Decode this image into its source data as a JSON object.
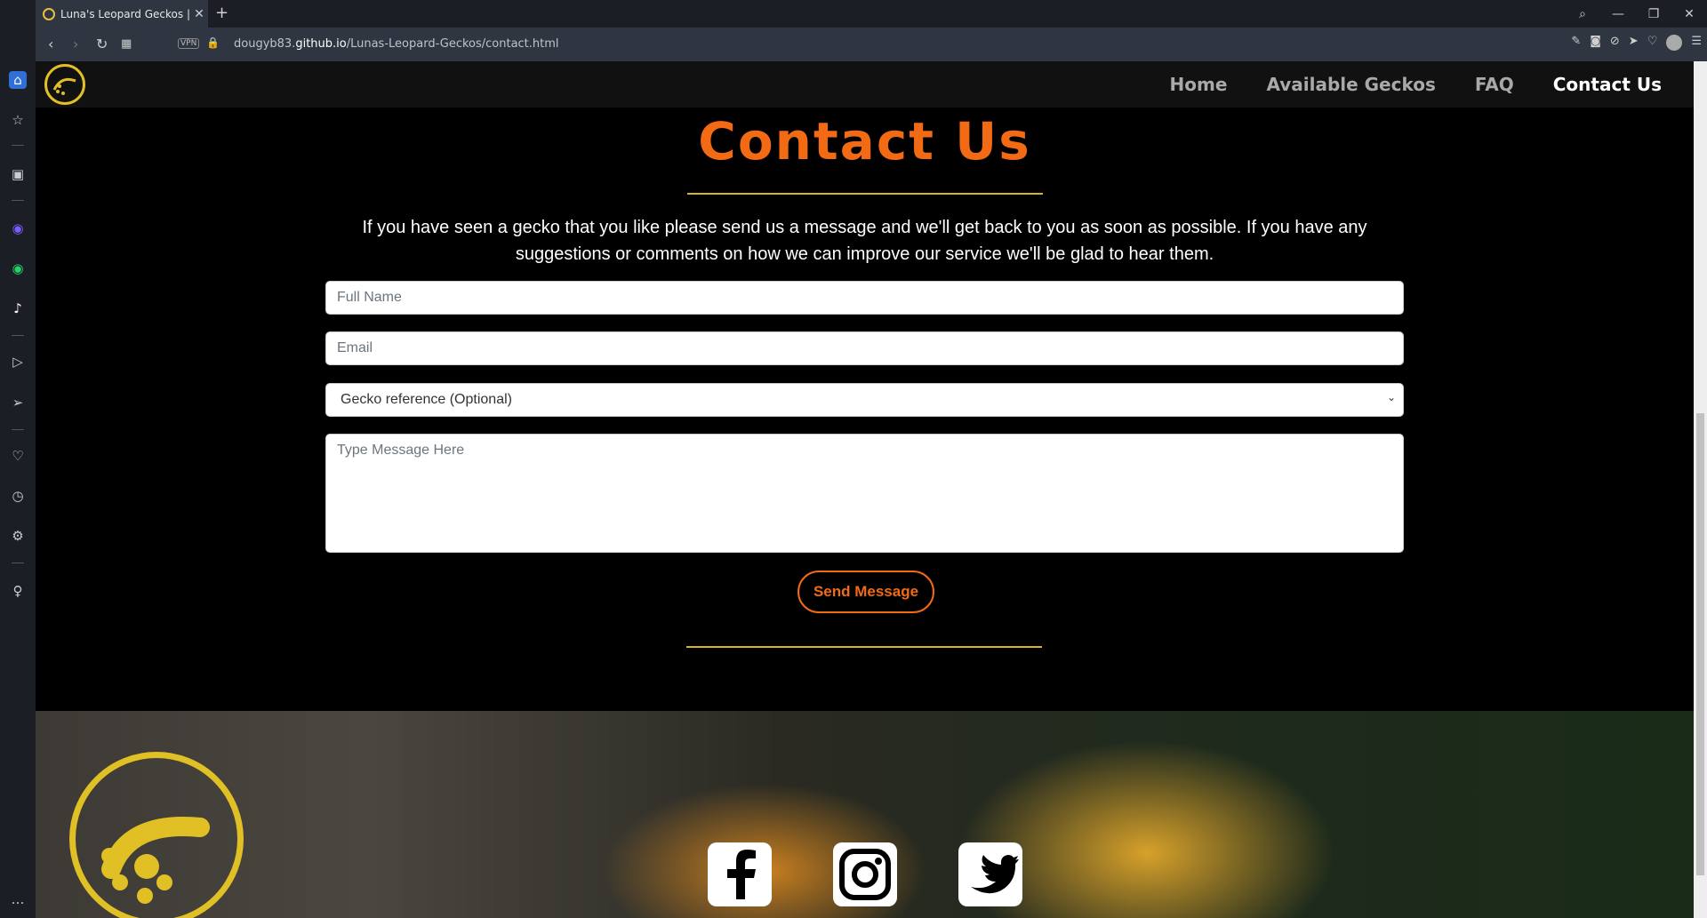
{
  "browser": {
    "tab_title": "Luna's Leopard Geckos | Co",
    "tab_close": "✕",
    "new_tab": "+",
    "vpn": "VPN",
    "url_prefix": "dougyb83.",
    "url_host": "github.io",
    "url_path": "/Lunas-Leopard-Geckos/contact.html"
  },
  "nav": {
    "home": "Home",
    "available": "Available Geckos",
    "faq": "FAQ",
    "contact": "Contact Us"
  },
  "main": {
    "title": "Contact Us",
    "intro": "If you have seen a gecko that you like please send us a message and we'll get back to you as soon as possible. If you have any suggestions or comments on how we can improve our service we'll be glad to hear them."
  },
  "form": {
    "fullname_placeholder": "Full Name",
    "email_placeholder": "Email",
    "gecko_select": "Gecko reference (Optional)",
    "message_placeholder": "Type Message Here",
    "send_label": "Send Message"
  },
  "colors": {
    "accent": "#f36a14",
    "gold": "#d3b625"
  }
}
